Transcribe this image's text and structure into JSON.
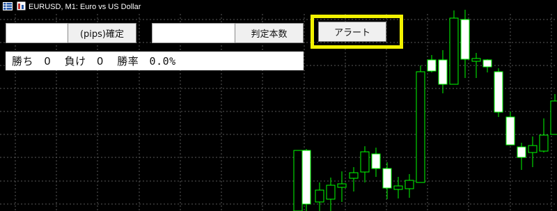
{
  "window": {
    "title": "EURUSD, M1:  Euro vs US Dollar"
  },
  "controls": {
    "pips_input_value": "",
    "pips_confirm_label": "(pips)確定",
    "judge_input_value": "",
    "judge_count_label": "判定本数",
    "alert_label": "アラート"
  },
  "stats": {
    "wins_label": "勝ち",
    "wins": "0",
    "losses_label": "負け",
    "losses": "0",
    "rate_label": "勝率",
    "rate": "0.0%"
  },
  "colors": {
    "bull": "#00ff00",
    "bear_fill": "#ffffff",
    "grid": "#5a5a5a",
    "highlight": "#f2f200"
  },
  "icons": [
    "table-icon",
    "chart-icon"
  ]
}
